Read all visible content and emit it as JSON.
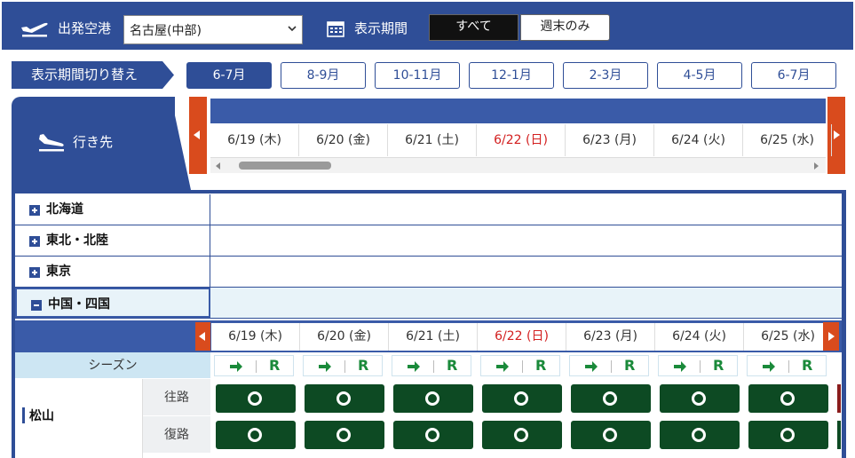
{
  "header": {
    "departure_label": "出発空港",
    "departure_value": "名古屋(中部)",
    "period_label": "表示期間",
    "segment_all": "すべて",
    "segment_weekend": "週末のみ"
  },
  "switch": {
    "label": "表示期間切り替え",
    "months": [
      "6-7月",
      "8-9月",
      "10-11月",
      "12-1月",
      "2-3月",
      "4-5月",
      "6-7月"
    ],
    "active_index": 0
  },
  "destination": {
    "label": "行き先"
  },
  "dates": [
    {
      "text": "6/19 (木)",
      "sunday": false
    },
    {
      "text": "6/20 (金)",
      "sunday": false
    },
    {
      "text": "6/21 (土)",
      "sunday": false
    },
    {
      "text": "6/22 (日)",
      "sunday": true
    },
    {
      "text": "6/23 (月)",
      "sunday": false
    },
    {
      "text": "6/24 (火)",
      "sunday": false
    },
    {
      "text": "6/25 (水)",
      "sunday": false
    }
  ],
  "regions": [
    {
      "name": "北海道",
      "expanded": false
    },
    {
      "name": "東北・北陸",
      "expanded": false
    },
    {
      "name": "東京",
      "expanded": false
    },
    {
      "name": "中国・四国",
      "expanded": true
    }
  ],
  "schedule": {
    "season_label": "シーズン",
    "season_code": "R",
    "city": "松山",
    "outbound_label": "往路",
    "return_label": "復路",
    "availability_symbol": "O",
    "outbound": [
      "available",
      "available",
      "available",
      "available",
      "available",
      "available",
      "available"
    ],
    "return": [
      "available",
      "available",
      "available",
      "available",
      "available",
      "available",
      "available"
    ]
  },
  "colors": {
    "brand": "#2f4e97",
    "accent": "#d94b1d",
    "available": "#0d4a23",
    "sunday": "#d32020"
  }
}
